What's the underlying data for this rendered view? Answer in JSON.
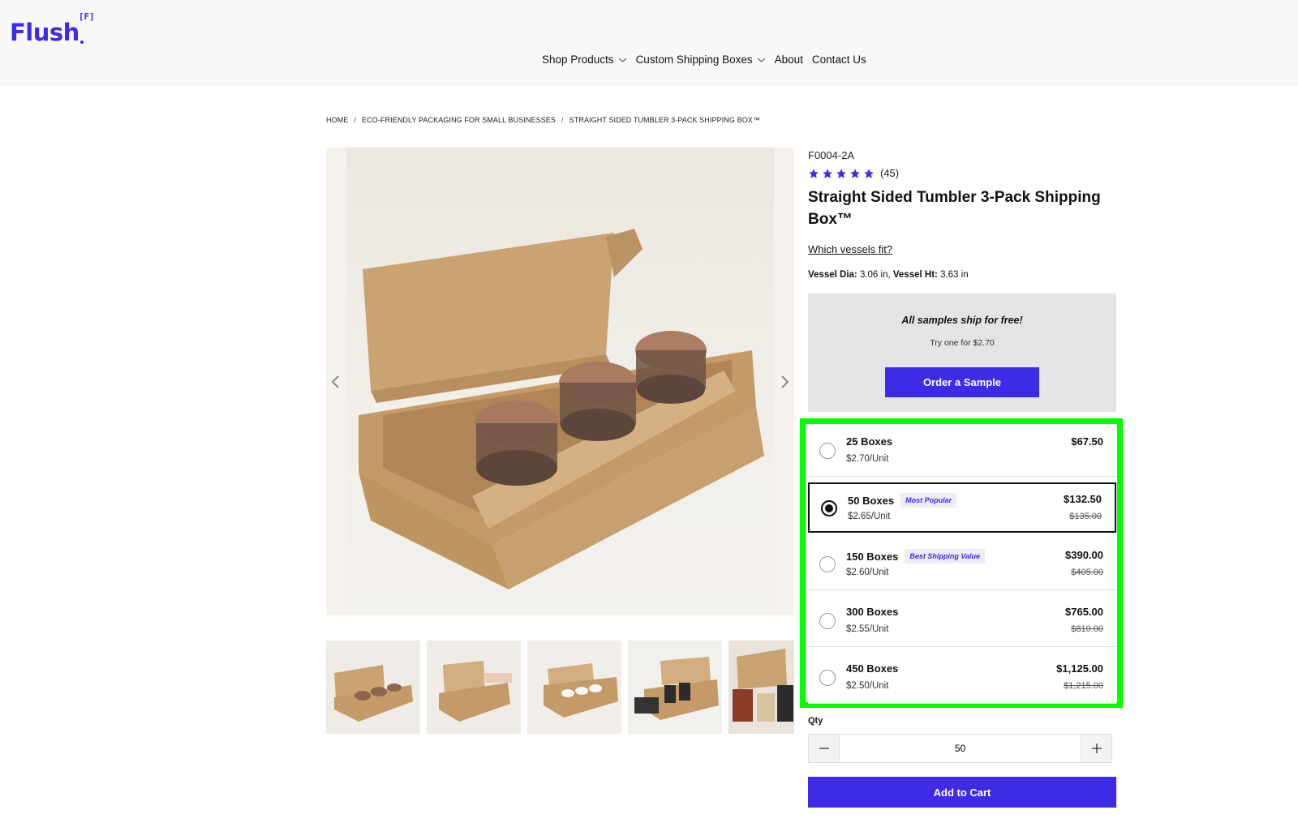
{
  "brand": {
    "name": "Flush",
    "mark": "[F]",
    "color": "#3d2be6"
  },
  "nav": {
    "items": [
      {
        "label": "Shop Products",
        "has_dropdown": true
      },
      {
        "label": "Custom Shipping Boxes",
        "has_dropdown": true
      },
      {
        "label": "About",
        "has_dropdown": false
      },
      {
        "label": "Contact Us",
        "has_dropdown": false
      }
    ]
  },
  "breadcrumb": [
    "HOME",
    "ECO-FRIENDLY PACKAGING FOR SMALL BUSINESSES",
    "STRAIGHT SIDED TUMBLER 3-PACK SHIPPING BOX™"
  ],
  "product": {
    "sku": "F0004-2A",
    "rating_stars": 5,
    "rating_count": "(45)",
    "title": "Straight Sided Tumbler 3-Pack Shipping Box™",
    "vessels_link": "Which vessels fit?",
    "dims": {
      "dia_label": "Vessel Dia:",
      "dia_value": "3.06 in,",
      "ht_label": "Vessel Ht:",
      "ht_value": "3.63 in"
    }
  },
  "sample": {
    "title": "All samples ship for free!",
    "subtitle": "Try one for $2.70",
    "button": "Order a Sample"
  },
  "options": [
    {
      "name": "25 Boxes",
      "badge": "",
      "unit": "$2.70/Unit",
      "price": "$67.50",
      "old_price": "",
      "selected": false
    },
    {
      "name": "50 Boxes",
      "badge": "Most Popular",
      "unit": "$2.65/Unit",
      "price": "$132.50",
      "old_price": "$135.00",
      "selected": true
    },
    {
      "name": "150 Boxes",
      "badge": "Best Shipping Value",
      "unit": "$2.60/Unit",
      "price": "$390.00",
      "old_price": "$405.00",
      "selected": false
    },
    {
      "name": "300 Boxes",
      "badge": "",
      "unit": "$2.55/Unit",
      "price": "$765.00",
      "old_price": "$810.00",
      "selected": false
    },
    {
      "name": "450 Boxes",
      "badge": "",
      "unit": "$2.50/Unit",
      "price": "$1,125.00",
      "old_price": "$1,215.00",
      "selected": false
    }
  ],
  "quantity": {
    "label": "Qty",
    "value": "50"
  },
  "cart": {
    "button": "Add to Cart"
  },
  "colors": {
    "accent": "#3d2be6",
    "highlight": "#00ff00",
    "sample_bg": "#e4e4e4"
  }
}
